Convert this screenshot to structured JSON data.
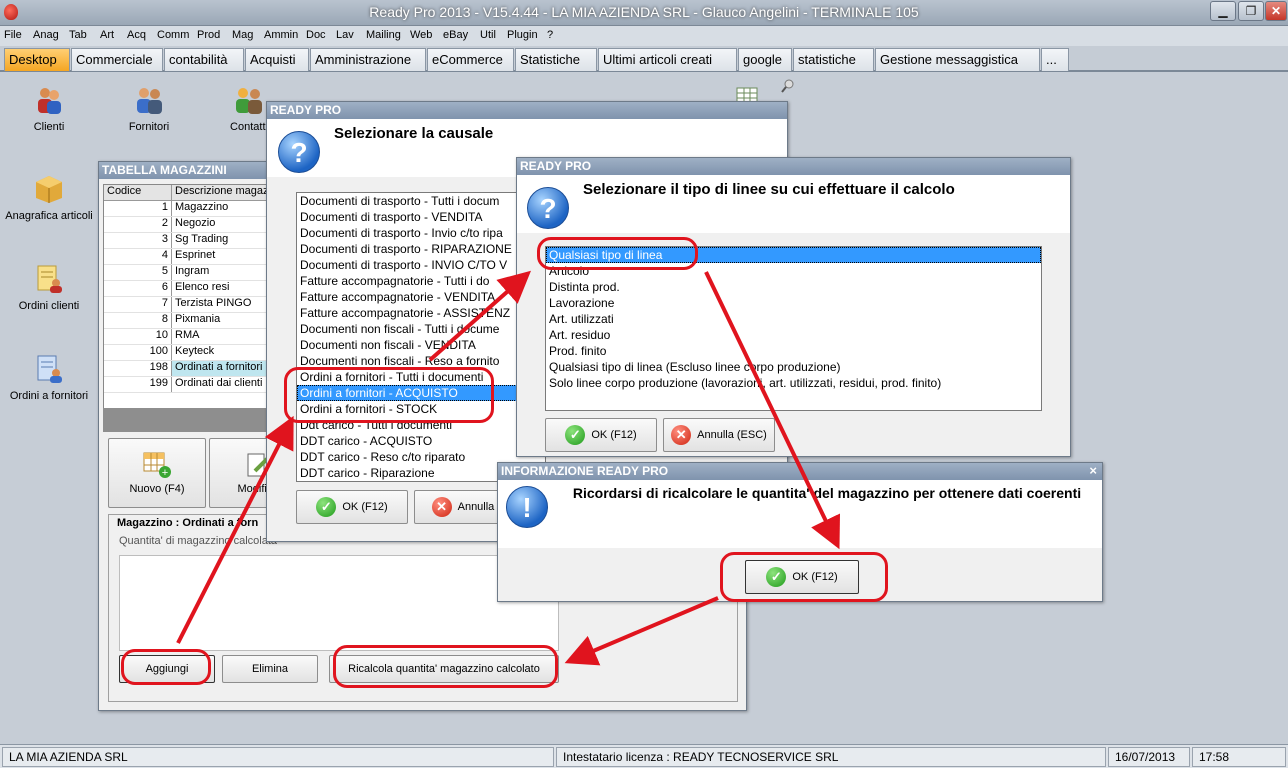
{
  "window": {
    "title": "Ready Pro 2013 - V15.4.44 - LA MIA AZIENDA SRL - Glauco Angelini - TERMINALE 105"
  },
  "menu": [
    "File",
    "Anag",
    "Tab",
    "Art",
    "Acq",
    "Comm",
    "Prod",
    "Mag",
    "Ammin",
    "Doc",
    "Lav",
    "Mailing",
    "Web",
    "eBay",
    "Util",
    "Plugin",
    "?"
  ],
  "tabs": [
    "Desktop",
    "Commerciale",
    "contabilità",
    "Acquisti",
    "Amministrazione",
    "eCommerce",
    "Statistiche",
    "Ultimi articoli creati",
    "google",
    "statistiche",
    "Gestione messaggistica",
    "..."
  ],
  "desktop_icons": [
    {
      "label": "Clienti",
      "icon": "clients-icon"
    },
    {
      "label": "Fornitori",
      "icon": "suppliers-icon"
    },
    {
      "label": "Contatti",
      "icon": "contacts-icon"
    },
    {
      "label": "Anagrafica articoli",
      "icon": "boxes-icon"
    },
    {
      "label": "Ordini clienti",
      "icon": "customer-orders-icon"
    },
    {
      "label": "Ordini a fornitori",
      "icon": "supplier-orders-icon"
    }
  ],
  "tabella_magazzini": {
    "title": "TABELLA MAGAZZINI",
    "headers": [
      "Codice",
      "Descrizione magaz"
    ],
    "rows": [
      {
        "codice": "1",
        "descrizione": "Magazzino"
      },
      {
        "codice": "2",
        "descrizione": "Negozio"
      },
      {
        "codice": "3",
        "descrizione": "Sg Trading"
      },
      {
        "codice": "4",
        "descrizione": "Esprinet"
      },
      {
        "codice": "5",
        "descrizione": "Ingram"
      },
      {
        "codice": "6",
        "descrizione": "Elenco resi"
      },
      {
        "codice": "7",
        "descrizione": "Terzista PINGO"
      },
      {
        "codice": "8",
        "descrizione": "Pixmania"
      },
      {
        "codice": "10",
        "descrizione": "RMA"
      },
      {
        "codice": "100",
        "descrizione": "Keyteck"
      },
      {
        "codice": "198",
        "descrizione": "Ordinati a fornitori"
      },
      {
        "codice": "199",
        "descrizione": "Ordinati dai clienti"
      }
    ],
    "btn_nuovo": "Nuovo (F4)",
    "btn_modifica": "Modifica",
    "section_label": "Magazzino : Ordinati a forn",
    "calc_label": "Quantita' di magazzino calcolata",
    "btn_aggiungi": "Aggiungi",
    "btn_elimina": "Elimina",
    "btn_ricalcola": "Ricalcola quantita' magazzino calcolato"
  },
  "dialog_causale": {
    "title": "READY PRO",
    "heading": "Selezionare la causale",
    "items": [
      "Documenti di trasporto - Tutti i docum",
      "Documenti di trasporto - VENDITA",
      "Documenti di trasporto - Invio c/to ripa",
      "Documenti di trasporto - RIPARAZIONE",
      "Documenti di trasporto - INVIO C/TO V",
      "Fatture accompagnatorie - Tutti i do",
      "Fatture accompagnatorie - VENDITA",
      "Fatture accompagnatorie - ASSISTENZ",
      "Documenti non fiscali - Tutti i docume",
      "Documenti non fiscali - VENDITA",
      "Documenti non fiscali - Reso a fornito",
      "Ordini a fornitori - Tutti i documenti",
      "Ordini a fornitori - ACQUISTO",
      "Ordini a fornitori - STOCK",
      "Ddt carico - Tutti i documenti",
      "DDT carico - ACQUISTO",
      "DDT carico - Reso c/to riparato",
      "DDT carico - Riparazione"
    ],
    "selected": "Ordini a fornitori - ACQUISTO",
    "ok": "OK (F12)",
    "cancel": "Annulla (E"
  },
  "dialog_linee": {
    "title": "READY PRO",
    "heading": "Selezionare il tipo di linee su cui effettuare il calcolo",
    "items": [
      "Qualsiasi tipo di linea",
      "Articolo",
      "Distinta prod.",
      "Lavorazione",
      "Art. utilizzati",
      "Art. residuo",
      "Prod. finito",
      "Qualsiasi tipo di linea (Escluso linee corpo produzione)",
      "Solo linee corpo produzione (lavorazioni, art. utilizzati, residui, prod. finito)"
    ],
    "selected": "Qualsiasi tipo di linea",
    "ok": "OK (F12)",
    "cancel": "Annulla (ESC)"
  },
  "dialog_info": {
    "title": "INFORMAZIONE READY PRO",
    "message": "Ricordarsi di ricalcolare le quantita' del magazzino per ottenere dati coerenti",
    "ok": "OK (F12)",
    "close": "×"
  },
  "statusbar": {
    "company": "LA MIA AZIENDA SRL",
    "license": "Intestatario licenza : READY TECNOSERVICE SRL",
    "date": "16/07/2013",
    "time": "17:58"
  },
  "colors": {
    "accent": "#f5a623",
    "highlight_red": "#e0141e",
    "selection": "#3399ff"
  }
}
